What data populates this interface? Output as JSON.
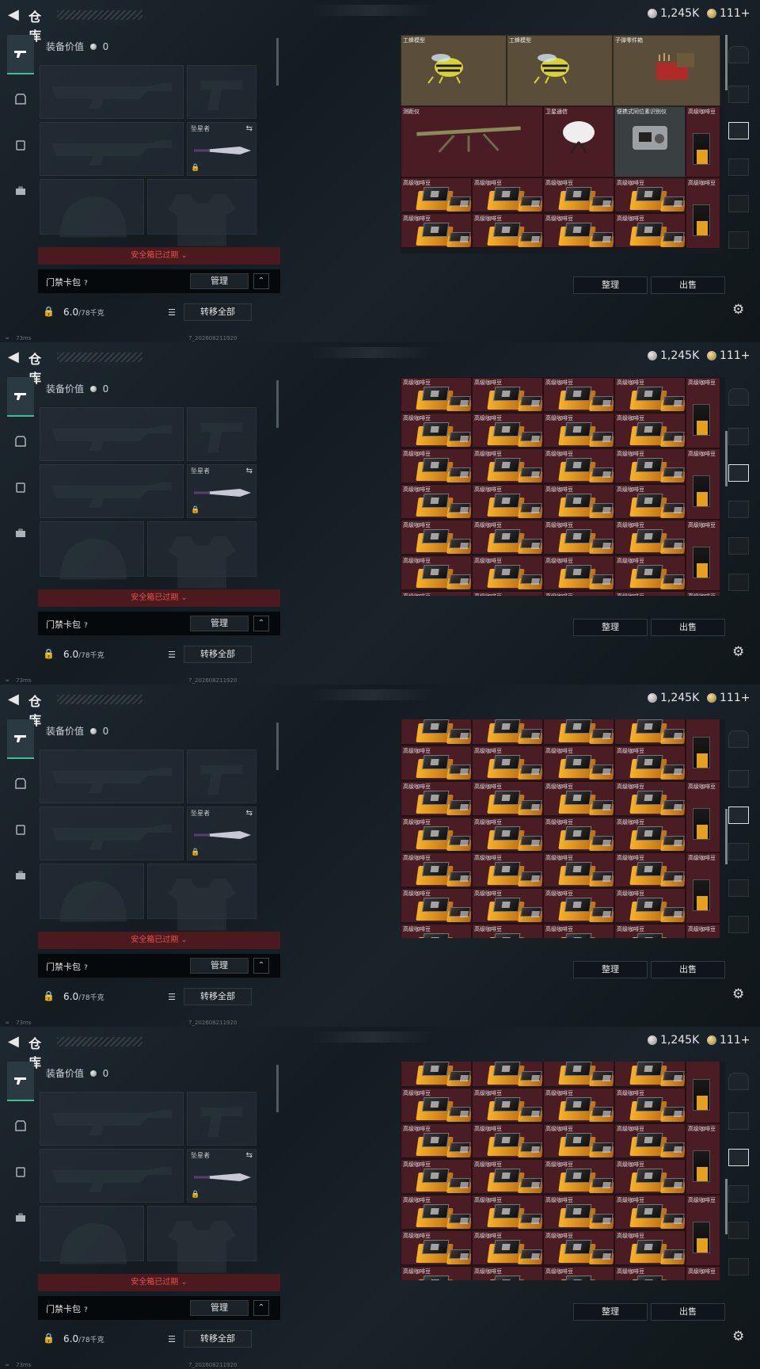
{
  "header": {
    "title": "仓库",
    "silver": "1,245K",
    "gold": "111+"
  },
  "equipment": {
    "value_label": "装备价值",
    "value": "0",
    "melee_slot_label": "坠星者",
    "safebox_status": "安全箱已过期",
    "access_card": {
      "label": "门禁卡包",
      "help": "?",
      "manage": "管理"
    },
    "weight": {
      "current": "6.0",
      "max": "/78千克"
    },
    "transfer_all": "转移全部"
  },
  "status_bar": {
    "ping": "73ms",
    "build": "7_202608211920"
  },
  "stash": {
    "sort_label": "整理",
    "sell_label": "出售",
    "frame1_items": [
      "工蜂模型",
      "工蜂模型",
      "子弹零件箱",
      "测距仪",
      "卫星通信",
      "便携式同位素识别仪",
      "高级咖啡豆"
    ],
    "coffee": "高级咖啡豆",
    "scroll_fractions": [
      0.0,
      0.33,
      0.55,
      0.72
    ]
  },
  "icons": {
    "back": "back-icon",
    "gun": "gun-tab-icon",
    "armor": "armor-tab-icon",
    "backpack": "backpack-tab-icon",
    "briefcase": "briefcase-tab-icon",
    "settings": "gear-icon",
    "lock": "lock-icon"
  },
  "colors": {
    "accent": "#3ac38f",
    "warning": "#e6534d",
    "item_bg": "#4a1d24"
  }
}
